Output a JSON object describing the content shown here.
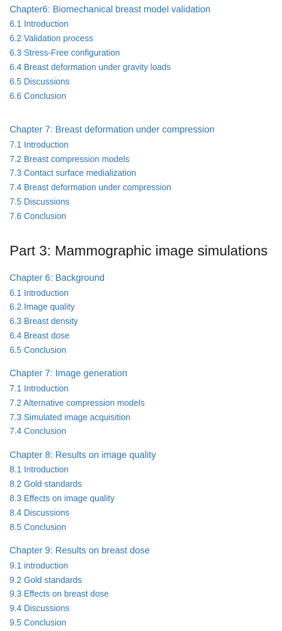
{
  "toc": {
    "block1": {
      "chapter": "Chapter6: Biomechanical breast model validation",
      "items": [
        "6.1 Introduction",
        "6.2 Validation process",
        "6.3 Stress-Free configuration",
        "6.4 Breast deformation under gravity loads",
        "6.5 Discussions",
        "6.6 Conclusion"
      ]
    },
    "block2": {
      "chapter": "Chapter 7: Breast deformation under compression",
      "items": [
        "7.1 Introduction",
        "7.2 Breast compression models",
        "7.3 Contact surface medialization",
        "7.4 Breast deformation under compression",
        "7.5 Discussions",
        "7.6 Conclusion"
      ]
    },
    "part3": {
      "title": "Part 3: Mammographic  image simulations"
    },
    "block3": {
      "chapter": "Chapter 6: Background",
      "items": [
        "6.1 Introduction",
        "6.2 Image quality",
        "6.3 Breast density",
        "6.4 Breast dose",
        "6.5 Conclusion"
      ]
    },
    "block4": {
      "chapter": "Chapter 7: Image generation",
      "items": [
        "7.1 Introduction",
        "7.2 Alternative compression models",
        "7.3 Simulated image acquisition",
        "7.4 Conclusion"
      ]
    },
    "block5": {
      "chapter": "Chapter 8: Results on image quality",
      "items": [
        "8.1 Introduction",
        "8.2 Gold standards",
        "8.3 Effects on image quality",
        "8.4 Discussions",
        "8.5 Conclusion"
      ]
    },
    "block6": {
      "chapter": "Chapter 9: Results on breast dose",
      "items": [
        "9.1 introduction",
        "9.2 Gold standards",
        "9.3 Effects on breast dose",
        "9.4 Discussions",
        "9.5 Conclusion"
      ]
    }
  },
  "colors": {
    "link_blue": "#2e74b5",
    "heading_text": "#1a1a1a",
    "background": "#ffffff"
  }
}
